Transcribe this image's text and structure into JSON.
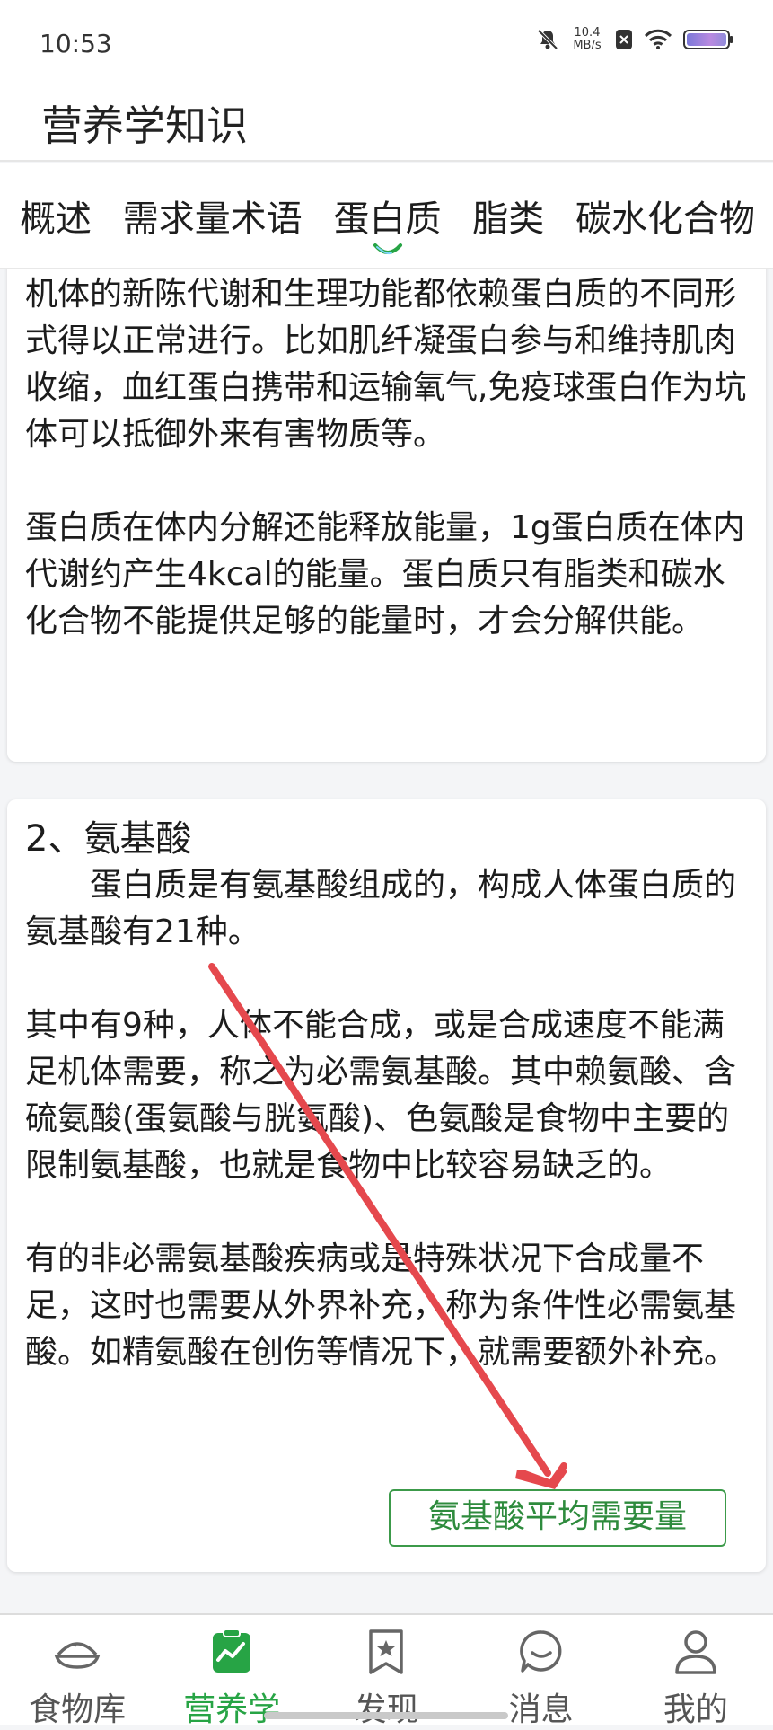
{
  "status_bar": {
    "time": "10:53",
    "net_speed_value": "10.4",
    "net_speed_unit": "MB/s"
  },
  "header": {
    "title": "营养学知识"
  },
  "tabs": [
    {
      "label": "概述",
      "active": false
    },
    {
      "label": "需求量术语",
      "active": false
    },
    {
      "label": "蛋白质",
      "active": true
    },
    {
      "label": "脂类",
      "active": false
    },
    {
      "label": "碳水化合物",
      "active": false
    }
  ],
  "card1": {
    "paragraph1": "机体的新陈代谢和生理功能都依赖蛋白质的不同形式得以正常进行。比如肌纤凝蛋白参与和维持肌肉收缩，血红蛋白携带和运输氧气,免疫球蛋白作为坑体可以抵御外来有害物质等。",
    "paragraph2": "蛋白质在体内分解还能释放能量，1g蛋白质在体内代谢约产生4kcal的能量。蛋白质只有脂类和碳水化合物不能提供足够的能量时，才会分解供能。"
  },
  "card2": {
    "title": "2、氨基酸",
    "paragraph1": "蛋白质是有氨基酸组成的，构成人体蛋白质的氨基酸有21种。",
    "paragraph2": "其中有9种，人体不能合成，或是合成速度不能满足机体需要，称之为必需氨基酸。其中赖氨酸、含硫氨酸(蛋氨酸与胱氨酸)、色氨酸是食物中主要的限制氨基酸，也就是食物中比较容易缺乏的。",
    "paragraph3": "有的非必需氨基酸疾病或是特殊状况下合成量不足，这时也需要从外界补充，称为条件性必需氨基酸。如精氨酸在创伤等情况下，就需要额外补充。",
    "button_label": "氨基酸平均需要量"
  },
  "bottom_nav": [
    {
      "label": "食物库",
      "icon": "food-bowl-icon",
      "active": false
    },
    {
      "label": "营养学",
      "icon": "nutrition-chart-icon",
      "active": true
    },
    {
      "label": "发现",
      "icon": "bookmark-star-icon",
      "active": false
    },
    {
      "label": "消息",
      "icon": "chat-bubble-icon",
      "active": false
    },
    {
      "label": "我的",
      "icon": "user-profile-icon",
      "active": false
    }
  ],
  "colors": {
    "accent": "#27a445",
    "annotation_arrow": "#e5484d",
    "button_border": "#3c9a4a"
  }
}
